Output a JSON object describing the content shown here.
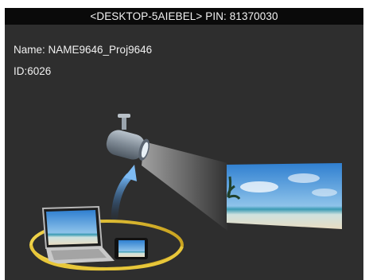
{
  "window": {
    "title": "<DESKTOP-5AIEBEL>  PIN: 81370030"
  },
  "device": {
    "name_text": "Name: NAME9646_Proj9646",
    "id_text": "ID:6026"
  },
  "illustration": {
    "icons": [
      "projector-icon",
      "laptop-icon",
      "smartphone-icon",
      "projected-screen-image",
      "upload-arrow-icon",
      "orbit-ring-icon"
    ]
  }
}
